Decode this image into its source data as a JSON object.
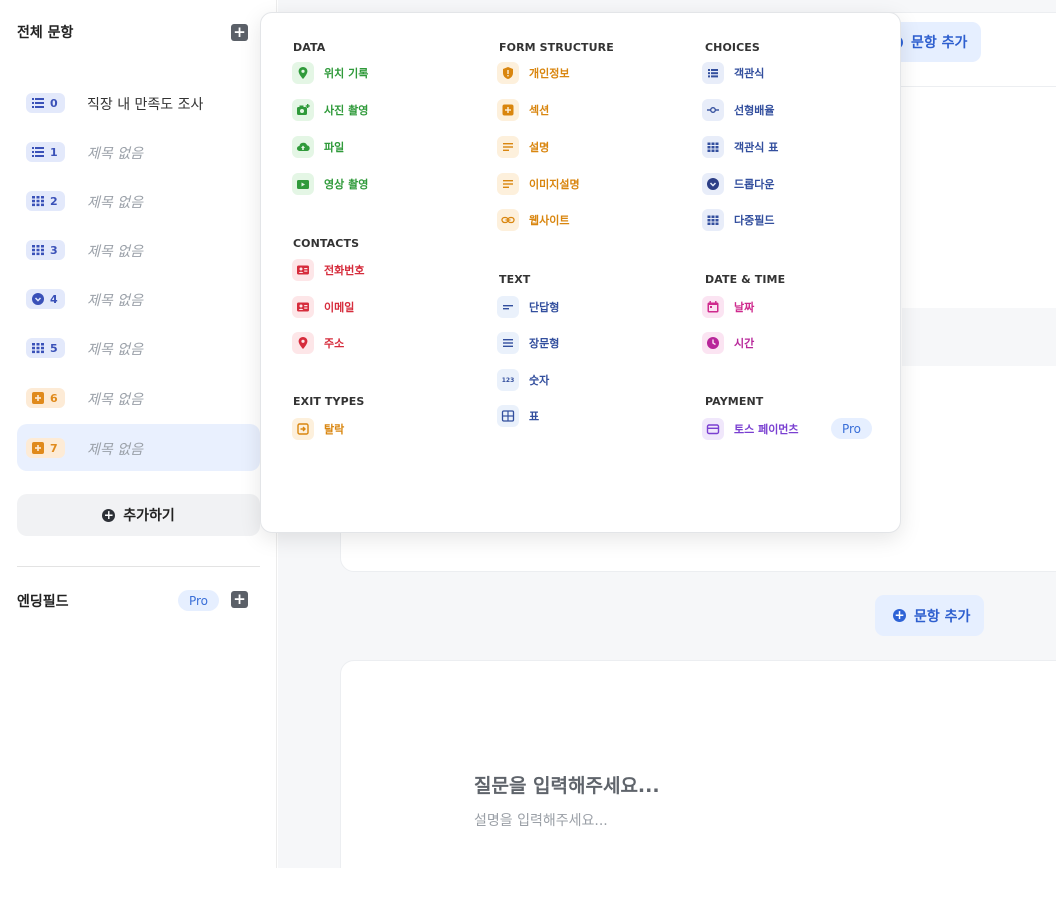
{
  "sidebar": {
    "header": "전체 문항",
    "questions": [
      {
        "num": "0",
        "title": "직장 내 만족도 조사",
        "icon": "list-icon",
        "color": "blue"
      },
      {
        "num": "1",
        "title": "제목 없음",
        "icon": "list-icon",
        "color": "blue"
      },
      {
        "num": "2",
        "title": "제목 없음",
        "icon": "grid-icon",
        "color": "blue"
      },
      {
        "num": "3",
        "title": "제목 없음",
        "icon": "grid-icon",
        "color": "blue"
      },
      {
        "num": "4",
        "title": "제목 없음",
        "icon": "dropdown-icon",
        "color": "blue"
      },
      {
        "num": "5",
        "title": "제목 없음",
        "icon": "grid-icon",
        "color": "blue"
      },
      {
        "num": "6",
        "title": "제목 없음",
        "icon": "section-icon",
        "color": "orange"
      },
      {
        "num": "7",
        "title": "제목 없음",
        "icon": "section-icon",
        "color": "orange"
      }
    ],
    "add_more": "추가하기",
    "ending_label": "엔딩필드",
    "pro": "Pro"
  },
  "main": {
    "add_question": "문항 추가",
    "question_placeholder": "질문을 입력해주세요...",
    "description_placeholder": "설명을 입력해주세요..."
  },
  "menu": {
    "data": {
      "title": "DATA",
      "items": [
        {
          "label": "위치 기록",
          "icon": "location-pin-icon"
        },
        {
          "label": "사진 촬영",
          "icon": "camera-icon"
        },
        {
          "label": "파일",
          "icon": "cloud-upload-icon"
        },
        {
          "label": "영상 촬영",
          "icon": "video-icon"
        }
      ]
    },
    "contacts": {
      "title": "CONTACTS",
      "items": [
        {
          "label": "전화번호",
          "icon": "contact-card-icon"
        },
        {
          "label": "이메일",
          "icon": "contact-card-icon"
        },
        {
          "label": "주소",
          "icon": "location-pin-icon"
        }
      ]
    },
    "exit_types": {
      "title": "EXIT TYPES",
      "items": [
        {
          "label": "탈락",
          "icon": "exit-icon"
        }
      ]
    },
    "form_structure": {
      "title": "FORM STRUCTURE",
      "items": [
        {
          "label": "개인정보",
          "icon": "shield-icon"
        },
        {
          "label": "섹션",
          "icon": "section-icon"
        },
        {
          "label": "설명",
          "icon": "text-lines-icon"
        },
        {
          "label": "이미지설명",
          "icon": "text-lines-icon"
        },
        {
          "label": "웹사이트",
          "icon": "link-icon"
        }
      ]
    },
    "text": {
      "title": "TEXT",
      "items": [
        {
          "label": "단답형",
          "icon": "short-text-icon"
        },
        {
          "label": "장문형",
          "icon": "long-text-icon"
        },
        {
          "label": "숫자",
          "icon": "number-icon",
          "icon_text": "123"
        },
        {
          "label": "표",
          "icon": "table-icon"
        }
      ]
    },
    "choices": {
      "title": "CHOICES",
      "items": [
        {
          "label": "객관식",
          "icon": "list-icon"
        },
        {
          "label": "선형배율",
          "icon": "linear-scale-icon"
        },
        {
          "label": "객관식 표",
          "icon": "grid-icon"
        },
        {
          "label": "드롭다운",
          "icon": "dropdown-icon"
        },
        {
          "label": "다중필드",
          "icon": "grid-icon"
        }
      ]
    },
    "date_time": {
      "title": "DATE & TIME",
      "items": [
        {
          "label": "날짜",
          "icon": "calendar-icon"
        },
        {
          "label": "시간",
          "icon": "clock-icon"
        }
      ]
    },
    "payment": {
      "title": "PAYMENT",
      "items": [
        {
          "label": "토스 페이먼츠",
          "icon": "credit-card-icon",
          "badge": "Pro"
        }
      ]
    }
  }
}
